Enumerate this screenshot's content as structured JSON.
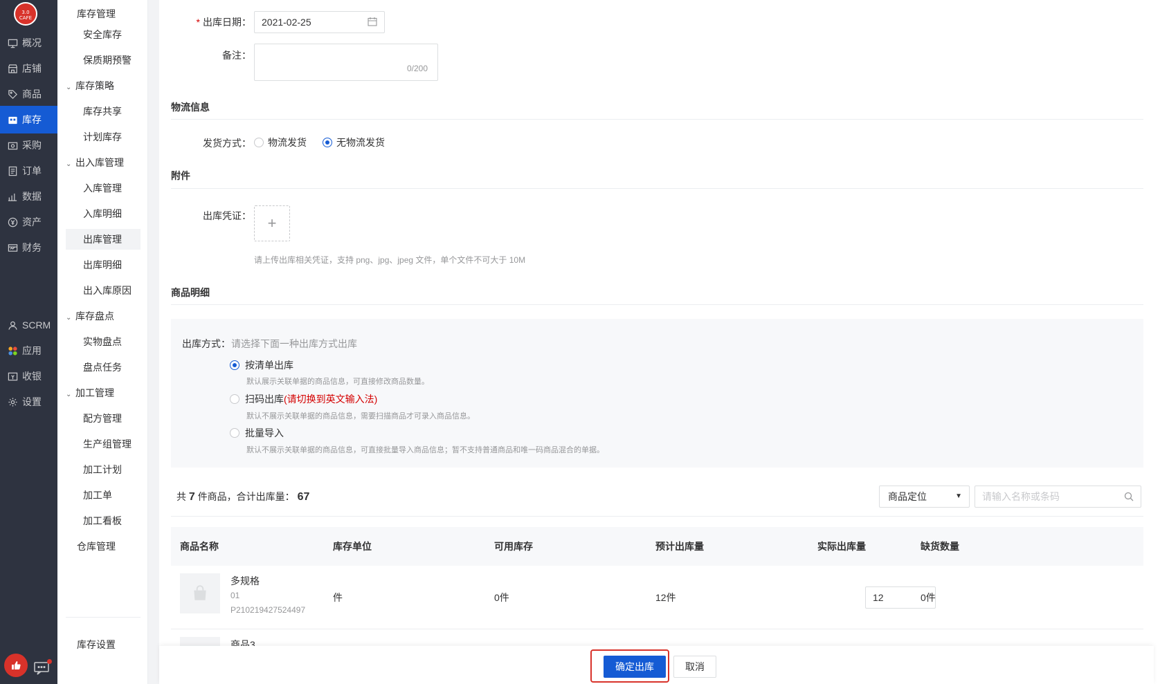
{
  "logo": {
    "line1": "3.0",
    "line2": "CAFE"
  },
  "nav": [
    {
      "label": "概况",
      "icon": "monitor-icon"
    },
    {
      "label": "店铺",
      "icon": "store-icon"
    },
    {
      "label": "商品",
      "icon": "tag-icon"
    },
    {
      "label": "库存",
      "icon": "warehouse-icon",
      "active": true
    },
    {
      "label": "采购",
      "icon": "purchase-icon"
    },
    {
      "label": "订单",
      "icon": "order-icon"
    },
    {
      "label": "数据",
      "icon": "chart-icon"
    },
    {
      "label": "资产",
      "icon": "asset-icon"
    },
    {
      "label": "财务",
      "icon": "finance-icon"
    },
    {
      "label": "SCRM",
      "icon": "user-icon"
    },
    {
      "label": "应用",
      "icon": "apps-icon"
    },
    {
      "label": "收银",
      "icon": "cashier-icon"
    },
    {
      "label": "设置",
      "icon": "gear-icon"
    }
  ],
  "subnav": {
    "title": "库存管理",
    "items": [
      {
        "label": "安全库存",
        "type": "item"
      },
      {
        "label": "保质期预警",
        "type": "item"
      },
      {
        "label": "库存策略",
        "type": "group"
      },
      {
        "label": "库存共享",
        "type": "item"
      },
      {
        "label": "计划库存",
        "type": "item"
      },
      {
        "label": "出入库管理",
        "type": "group"
      },
      {
        "label": "入库管理",
        "type": "item"
      },
      {
        "label": "入库明细",
        "type": "item"
      },
      {
        "label": "出库管理",
        "type": "item",
        "active": true
      },
      {
        "label": "出库明细",
        "type": "item"
      },
      {
        "label": "出入库原因",
        "type": "item"
      },
      {
        "label": "库存盘点",
        "type": "group"
      },
      {
        "label": "实物盘点",
        "type": "item"
      },
      {
        "label": "盘点任务",
        "type": "item"
      },
      {
        "label": "加工管理",
        "type": "group"
      },
      {
        "label": "配方管理",
        "type": "item"
      },
      {
        "label": "生产组管理",
        "type": "item"
      },
      {
        "label": "加工计划",
        "type": "item"
      },
      {
        "label": "加工单",
        "type": "item"
      },
      {
        "label": "加工看板",
        "type": "item"
      },
      {
        "label": "仓库管理",
        "type": "plain"
      }
    ],
    "settings": "库存设置"
  },
  "form": {
    "date_label": "出库日期：",
    "date_value": "2021-02-25",
    "remark_label": "备注：",
    "remark_count": "0/200"
  },
  "logistics": {
    "section_title": "物流信息",
    "label": "发货方式：",
    "option1": "物流发货",
    "option2": "无物流发货",
    "selected": "无物流发货"
  },
  "attachment": {
    "section_title": "附件",
    "label": "出库凭证：",
    "upload_symbol": "+",
    "hint": "请上传出库相关凭证，支持 png、jpg、jpeg 文件，单个文件不可大于 10M"
  },
  "goods": {
    "section_title": "商品明细",
    "mode_label": "出库方式：",
    "mode_placeholder": "请选择下面一种出库方式出库",
    "modes": [
      {
        "title": "按清单出库",
        "note": "",
        "desc": "默认展示关联单据的商品信息，可直接修改商品数量。",
        "selected": true
      },
      {
        "title": "扫码出库",
        "note": "(请切换到英文输入法)",
        "desc": "默认不展示关联单据的商品信息，需要扫描商品才可录入商品信息。",
        "selected": false
      },
      {
        "title": "批量导入",
        "note": "",
        "desc": "默认不展示关联单据的商品信息，可直接批量导入商品信息；暂不支持普通商品和唯一码商品混合的单据。",
        "selected": false
      }
    ],
    "summary_prefix": "共",
    "summary_count": "7",
    "summary_mid": "件商品，合计出库量：",
    "summary_total": "67",
    "locate_select": "商品定位",
    "search_placeholder": "请输入名称或条码"
  },
  "table": {
    "headers": [
      "商品名称",
      "库存单位",
      "可用库存",
      "预计出库量",
      "实际出库量",
      "缺货数量"
    ],
    "rows": [
      {
        "name": "多规格",
        "spec": "01",
        "code": "P210219427524497",
        "unit": "件",
        "available": "0件",
        "expected": "12件",
        "actual": "12",
        "shortage": "0件"
      }
    ],
    "partial_row_name": "商品3"
  },
  "footer": {
    "confirm": "确定出库",
    "cancel": "取消"
  }
}
